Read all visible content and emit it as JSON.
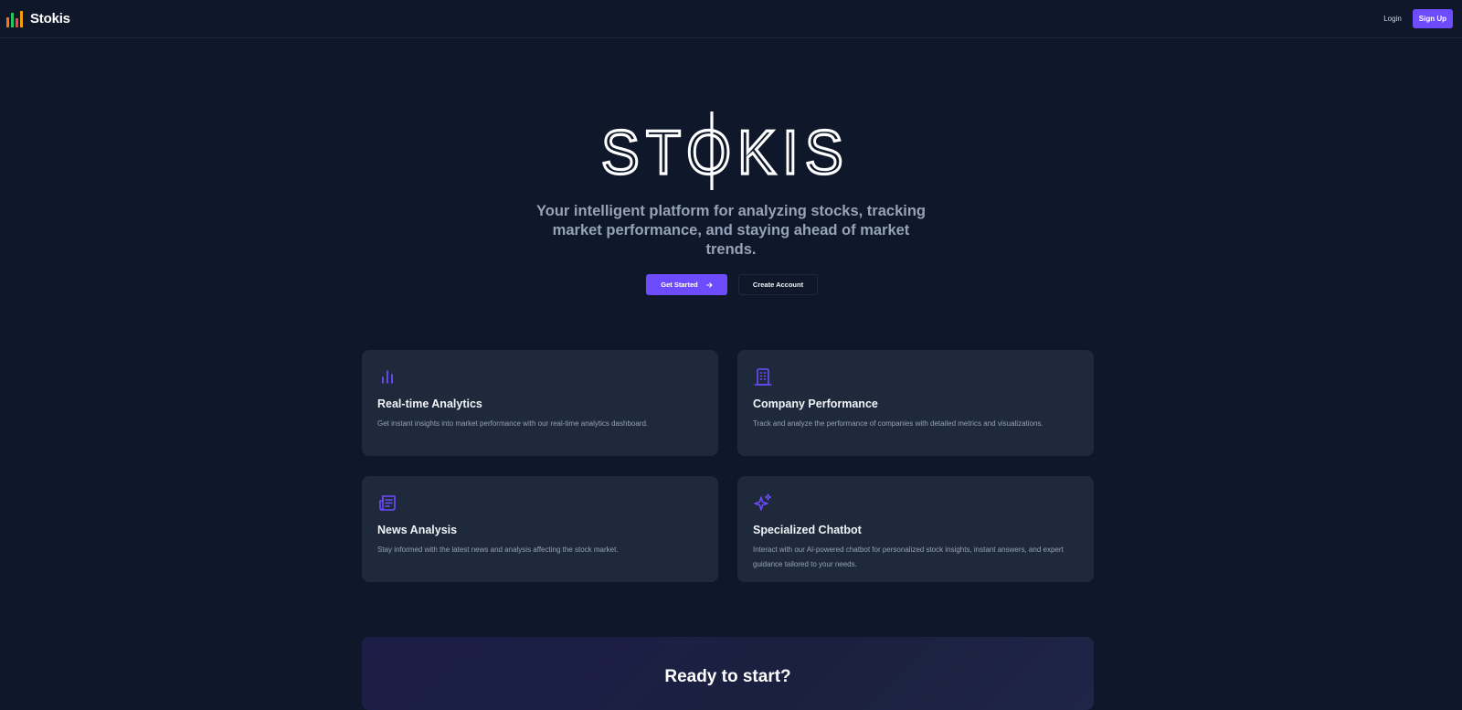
{
  "nav": {
    "brand": "Stokis",
    "login": "Login",
    "signup": "Sign Up"
  },
  "hero": {
    "logo_text": "STOKIS",
    "tagline": "Your intelligent platform for analyzing stocks, tracking market performance, and staying ahead of market trends.",
    "get_started": "Get Started",
    "create_account": "Create Account"
  },
  "features": [
    {
      "icon": "bar-chart-icon",
      "title": "Real-time Analytics",
      "description": "Get instant insights into market performance with our real-time analytics dashboard."
    },
    {
      "icon": "building-icon",
      "title": "Company Performance",
      "description": "Track and analyze the performance of companies with detailed metrics and visualizations."
    },
    {
      "icon": "newspaper-icon",
      "title": "News Analysis",
      "description": "Stay informed with the latest news and analysis affecting the stock market."
    },
    {
      "icon": "sparkles-icon",
      "title": "Specialized Chatbot",
      "description": "Interact with our AI-powered chatbot for personalized stock insights, instant answers, and expert guidance tailored to your needs."
    }
  ],
  "cta": {
    "title": "Ready to start?"
  },
  "colors": {
    "background": "#0f172a",
    "card": "#1e293b",
    "accent": "#6d4cff",
    "muted_text": "#94a3b8"
  }
}
